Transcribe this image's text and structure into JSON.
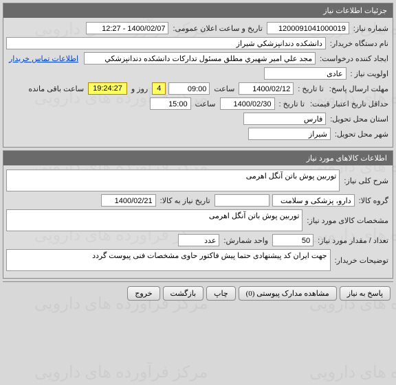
{
  "need_info": {
    "header": "جزئیات اطلاعات نیاز",
    "labels": {
      "need_number": "شماره نیاز:",
      "announce_datetime": "تاریخ و ساعت اعلان عمومی:",
      "buyer_device": "نام دستگاه خریدار:",
      "request_creator": "ایجاد کننده درخواست:",
      "contact_link": "اطلاعات تماس خریدار",
      "priority": "اولویت نیاز :",
      "reply_deadline": "مهلت ارسال پاسخ:",
      "until_date": "تا تاریخ :",
      "time": "ساعت",
      "day_and": "روز و",
      "hours_remain": "ساعت باقی مانده",
      "validity_min": "حداقل تاریخ اعتبار قیمت:",
      "delivery_province": "استان محل تحویل:",
      "delivery_city": "شهر محل تحویل:"
    },
    "values": {
      "need_number": "1200091041000019",
      "announce_datetime": "1400/02/07 - 12:27",
      "buyer_device": "دانشکده دندانپزشکي شيراز",
      "request_creator": "مجد علي امير شهيري مطلق مسئول تدارکات دانشکده دندانپزشکي شيراز",
      "priority": "عادی",
      "reply_until_date": "1400/02/12",
      "reply_until_time": "09:00",
      "days_remain": "4",
      "hours_remain": "19:24:27",
      "validity_until_date": "1400/02/30",
      "validity_until_time": "15:00",
      "delivery_province": "فارس",
      "delivery_city": "شيراز"
    }
  },
  "goods_info": {
    "header": "اطلاعات کالاهای مورد نیاز",
    "labels": {
      "general_desc": "شرح کلی نیاز:",
      "goods_group": "گروه کالا:",
      "need_date": "تاریخ نیاز به کالا:",
      "goods_specs": "مشخصات کالای مورد نیاز:",
      "quantity": "تعداد / مقدار مورد نیاز:",
      "count_unit": "واحد شمارش:",
      "buyer_notes": "توضیحات خریدار:"
    },
    "values": {
      "general_desc": "توربین پوش باتن آنگل اهرمی",
      "goods_group": "دارو، پزشکی و سلامت",
      "goods_group_code": "",
      "need_date": "1400/02/21",
      "goods_specs": "توربین پوش باتن آنگل اهرمی",
      "quantity": "50",
      "count_unit": "عدد",
      "buyer_notes": "جهت ایران کد پیشنهادی حتما پیش فاکتور حاوی مشخصات فنی پیوست گردد"
    }
  },
  "footer": {
    "reply": "پاسخ به نیاز",
    "attachments": "مشاهده مدارک پیوستی (0)",
    "print": "چاپ",
    "back": "بازگشت",
    "exit": "خروج"
  }
}
